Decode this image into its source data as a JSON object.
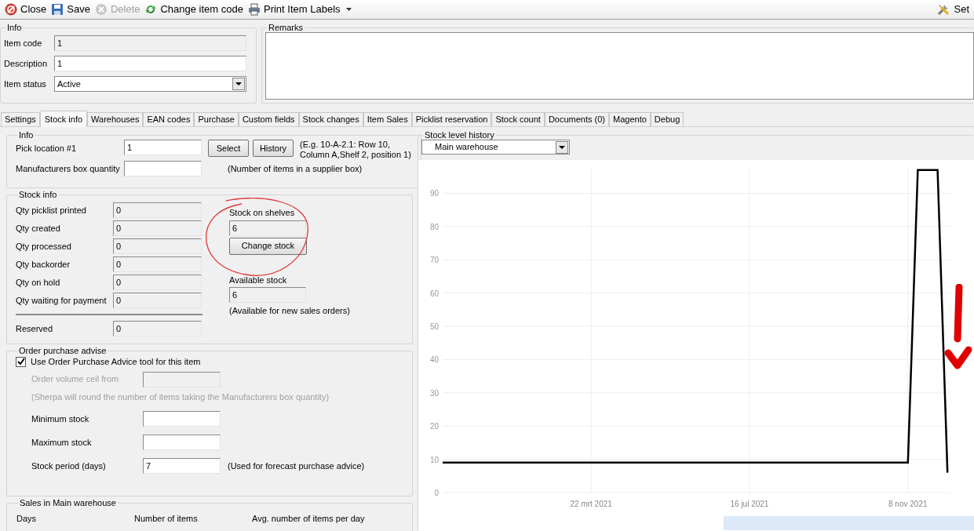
{
  "toolbar": [
    {
      "kind": "close",
      "label": "Close",
      "disabled": false
    },
    {
      "kind": "save",
      "label": "Save",
      "disabled": false
    },
    {
      "kind": "delete",
      "label": "Delete",
      "disabled": true
    },
    {
      "kind": "change",
      "label": "Change item code",
      "disabled": false
    },
    {
      "kind": "print",
      "label": "Print Item Labels",
      "disabled": false,
      "dropdown": true
    },
    {
      "kind": "settings",
      "label": "Set",
      "disabled": false
    }
  ],
  "info": {
    "title": "Info",
    "fields": [
      {
        "kind": "readonly",
        "label": "Item code",
        "value": "1"
      },
      {
        "kind": "text",
        "label": "Description",
        "value": "1"
      },
      {
        "kind": "select",
        "label": "Item status",
        "value": "Active"
      }
    ]
  },
  "remarks": {
    "title": "Remarks"
  },
  "tabs": [
    {
      "label": "Settings",
      "selected": false
    },
    {
      "label": "Stock info",
      "selected": true
    },
    {
      "label": "Warehouses",
      "selected": false
    },
    {
      "label": "EAN codes",
      "selected": false
    },
    {
      "label": "Purchase",
      "selected": false
    },
    {
      "label": "Custom fields",
      "selected": false
    },
    {
      "label": "Stock changes",
      "selected": false
    },
    {
      "label": "Item Sales",
      "selected": false
    },
    {
      "label": "Picklist reservation",
      "selected": false
    },
    {
      "label": "Stock count",
      "selected": false
    },
    {
      "label": "Documents (0)",
      "selected": false
    },
    {
      "label": "Magento",
      "selected": false
    },
    {
      "label": "Debug",
      "selected": false
    }
  ],
  "pick_info": {
    "title": "Info",
    "pick_label": "Pick location #1",
    "pick_value": "1",
    "select_button": "Select",
    "history_button": "History",
    "pick_hint": "(E.g. 10-A-2.1: Row 10, Column A,Shelf 2, position 1)",
    "box_label": "Manufacturers box quantity",
    "box_hint": "(Number of items in a supplier box)"
  },
  "stock_info": {
    "title": "Stock info",
    "rows": [
      {
        "label": "Qty picklist printed",
        "value": "0"
      },
      {
        "label": "Qty created",
        "value": "0"
      },
      {
        "label": "Qty processed",
        "value": "0"
      },
      {
        "label": "Qty backorder",
        "value": "0"
      },
      {
        "label": "Qty on hold",
        "value": "0"
      },
      {
        "label": "Qty waiting for payment",
        "value": "0"
      }
    ],
    "reserved": {
      "label": "Reserved",
      "value": "0"
    },
    "shelves": {
      "label": "Stock on shelves",
      "value": "6",
      "button": "Change stock"
    },
    "available": {
      "label": "Available stock",
      "value": "6",
      "note": "(Available for new sales orders)"
    }
  },
  "order_advise": {
    "title": "Order purchase advise",
    "checkbox_label": "Use Order Purchase Advice tool for this item",
    "checked": true,
    "ceil": {
      "label": "Order volume ceil from",
      "disabled": true,
      "note": "(Sherpa will round the number of items taking the Manufacturers box quantity)"
    },
    "fields": [
      {
        "label": "Minimum stock"
      },
      {
        "label": "Maximum stock"
      }
    ],
    "period": {
      "label": "Stock period (days)",
      "value": "7",
      "note": "(Used for forecast purchase advice)"
    }
  },
  "sales": {
    "title": "Sales in Main warehouse",
    "columns": [
      "Days",
      "Number of items",
      "Avg. number of items per day"
    ]
  },
  "history": {
    "title": "Stock level history",
    "warehouse": "Main warehouse",
    "chart_data": {
      "type": "line",
      "grid": true,
      "categories": [
        null,
        null,
        null,
        null,
        null,
        null,
        null,
        null,
        null,
        null,
        null,
        null,
        null,
        null,
        null,
        "22 mrt 2021",
        null,
        null,
        null,
        null,
        null,
        null,
        null,
        null,
        null,
        null,
        null,
        null,
        null,
        null,
        null,
        "16 jul 2021",
        null,
        null,
        null,
        null,
        null,
        null,
        null,
        null,
        null,
        null,
        null,
        null,
        null,
        null,
        null,
        "8 nov 2021",
        null,
        null,
        null,
        null
      ],
      "series": [
        {
          "color": "#000000",
          "values": [
            9,
            9,
            9,
            9,
            9,
            9,
            9,
            9,
            9,
            9,
            9,
            9,
            9,
            9,
            9,
            9,
            9,
            9,
            9,
            9,
            9,
            9,
            9,
            9,
            9,
            9,
            9,
            9,
            9,
            9,
            9,
            9,
            9,
            9,
            9,
            9,
            9,
            9,
            9,
            9,
            9,
            9,
            9,
            9,
            9,
            9,
            9,
            9,
            97,
            97,
            97,
            6
          ]
        }
      ],
      "ylim": [
        0,
        100
      ],
      "yticks": [
        0,
        10,
        20,
        30,
        40,
        50,
        60,
        70,
        80,
        90
      ]
    }
  }
}
